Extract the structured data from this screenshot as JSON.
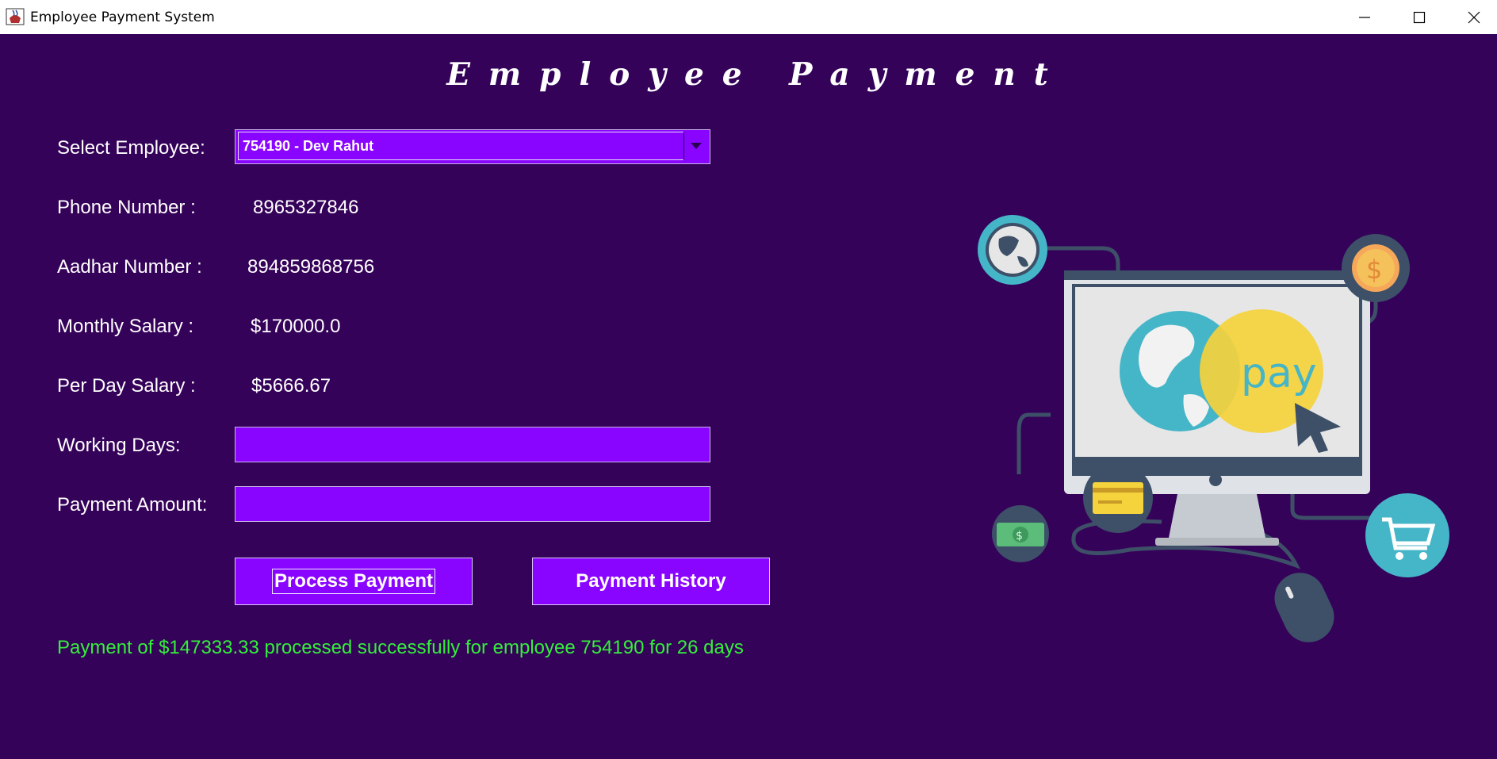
{
  "window": {
    "title": "Employee Payment System",
    "app_icon": "java-coffee-icon",
    "controls": [
      "minimize-icon",
      "maximize-icon",
      "close-icon"
    ]
  },
  "heading": "Employee Payment",
  "form": {
    "select_employee_label": "Select Employee:",
    "selected_employee": "754190 - Dev Rahut",
    "phone_label": "Phone Number :",
    "phone_value": "8965327846",
    "aadhar_label": "Aadhar Number :",
    "aadhar_value": "894859868756",
    "monthly_label": "Monthly Salary :",
    "monthly_value": "$170000.0",
    "perday_label": "Per Day Salary :",
    "perday_value": "$5666.67",
    "working_days_label": "Working Days:",
    "working_days_value": "",
    "payment_amount_label": "Payment Amount:",
    "payment_amount_value": ""
  },
  "buttons": {
    "process": "Process Payment",
    "history": "Payment History"
  },
  "status_message": "Payment of $147333.33 processed successfully for employee 754190 for 26 days",
  "illustration": {
    "screen_text": "pay",
    "icons": [
      "globe-icon",
      "dollar-coin-icon",
      "credit-card-icon",
      "banknote-icon",
      "shopping-cart-icon",
      "mouse-icon",
      "cursor-icon"
    ]
  },
  "colors": {
    "background": "#35025a",
    "accent_purple": "#8a05ff",
    "status_green": "#33f03a",
    "teal": "#45b5c8",
    "yellow": "#f5d33c"
  }
}
